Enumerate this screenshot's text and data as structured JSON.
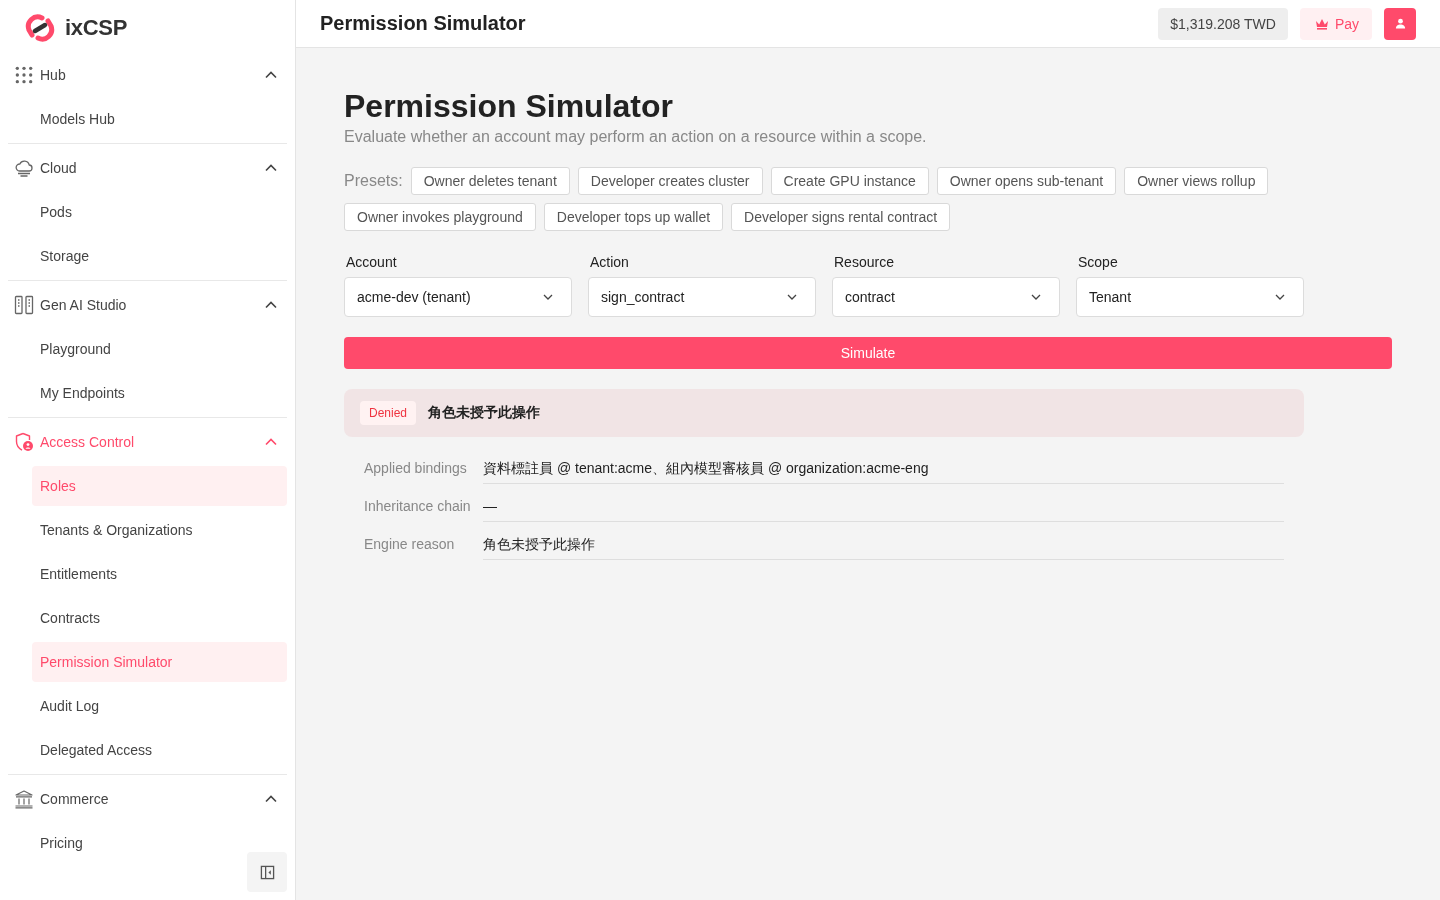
{
  "sidebar": {
    "logo": {
      "text": "ixCSP"
    },
    "groups": [
      {
        "label": "Hub",
        "expanded": true,
        "active": false,
        "items": [
          {
            "label": "Models Hub",
            "selected": false
          }
        ]
      },
      {
        "label": "Cloud",
        "expanded": true,
        "active": false,
        "items": [
          {
            "label": "Pods",
            "selected": false
          },
          {
            "label": "Storage",
            "selected": false
          }
        ]
      },
      {
        "label": "Gen AI Studio",
        "expanded": true,
        "active": false,
        "items": [
          {
            "label": "Playground",
            "selected": false
          },
          {
            "label": "My Endpoints",
            "selected": false
          }
        ]
      },
      {
        "label": "Access Control",
        "expanded": true,
        "active": true,
        "items": [
          {
            "label": "Roles",
            "selected": true
          },
          {
            "label": "Tenants & Organizations",
            "selected": false
          },
          {
            "label": "Entitlements",
            "selected": false
          },
          {
            "label": "Contracts",
            "selected": false
          },
          {
            "label": "Permission Simulator",
            "selected": true
          },
          {
            "label": "Audit Log",
            "selected": false
          },
          {
            "label": "Delegated Access",
            "selected": false
          }
        ]
      },
      {
        "label": "Commerce",
        "expanded": true,
        "active": false,
        "items": [
          {
            "label": "Pricing",
            "selected": false
          }
        ]
      }
    ]
  },
  "header": {
    "title": "Permission Simulator",
    "balance": "$1,319.208 TWD",
    "pay_button": "Pay"
  },
  "page": {
    "title": "Permission Simulator",
    "subtitle": "Evaluate whether an account may perform an action on a resource within a scope.",
    "presets_label": "Presets:",
    "presets": [
      "Owner deletes tenant",
      "Developer creates cluster",
      "Create GPU instance",
      "Owner opens sub-tenant",
      "Owner views rollup",
      "Owner invokes playground",
      "Developer tops up wallet",
      "Developer signs rental contract"
    ]
  },
  "form": {
    "fields": [
      {
        "label": "Account",
        "value": "acme-dev (tenant)"
      },
      {
        "label": "Action",
        "value": "sign_contract"
      },
      {
        "label": "Resource",
        "value": "contract"
      },
      {
        "label": "Scope",
        "value": "Tenant"
      }
    ],
    "submit_button": "Simulate"
  },
  "result": {
    "allowed": false,
    "badge": "Denied",
    "message": "角色未授予此操作",
    "details": [
      {
        "label": "Applied bindings",
        "value": "資料標註員 @ tenant:acme、組內模型審核員 @ organization:acme-eng"
      },
      {
        "label": "Inheritance chain",
        "value": "—"
      },
      {
        "label": "Engine reason",
        "value": "角色未授予此操作"
      }
    ]
  }
}
